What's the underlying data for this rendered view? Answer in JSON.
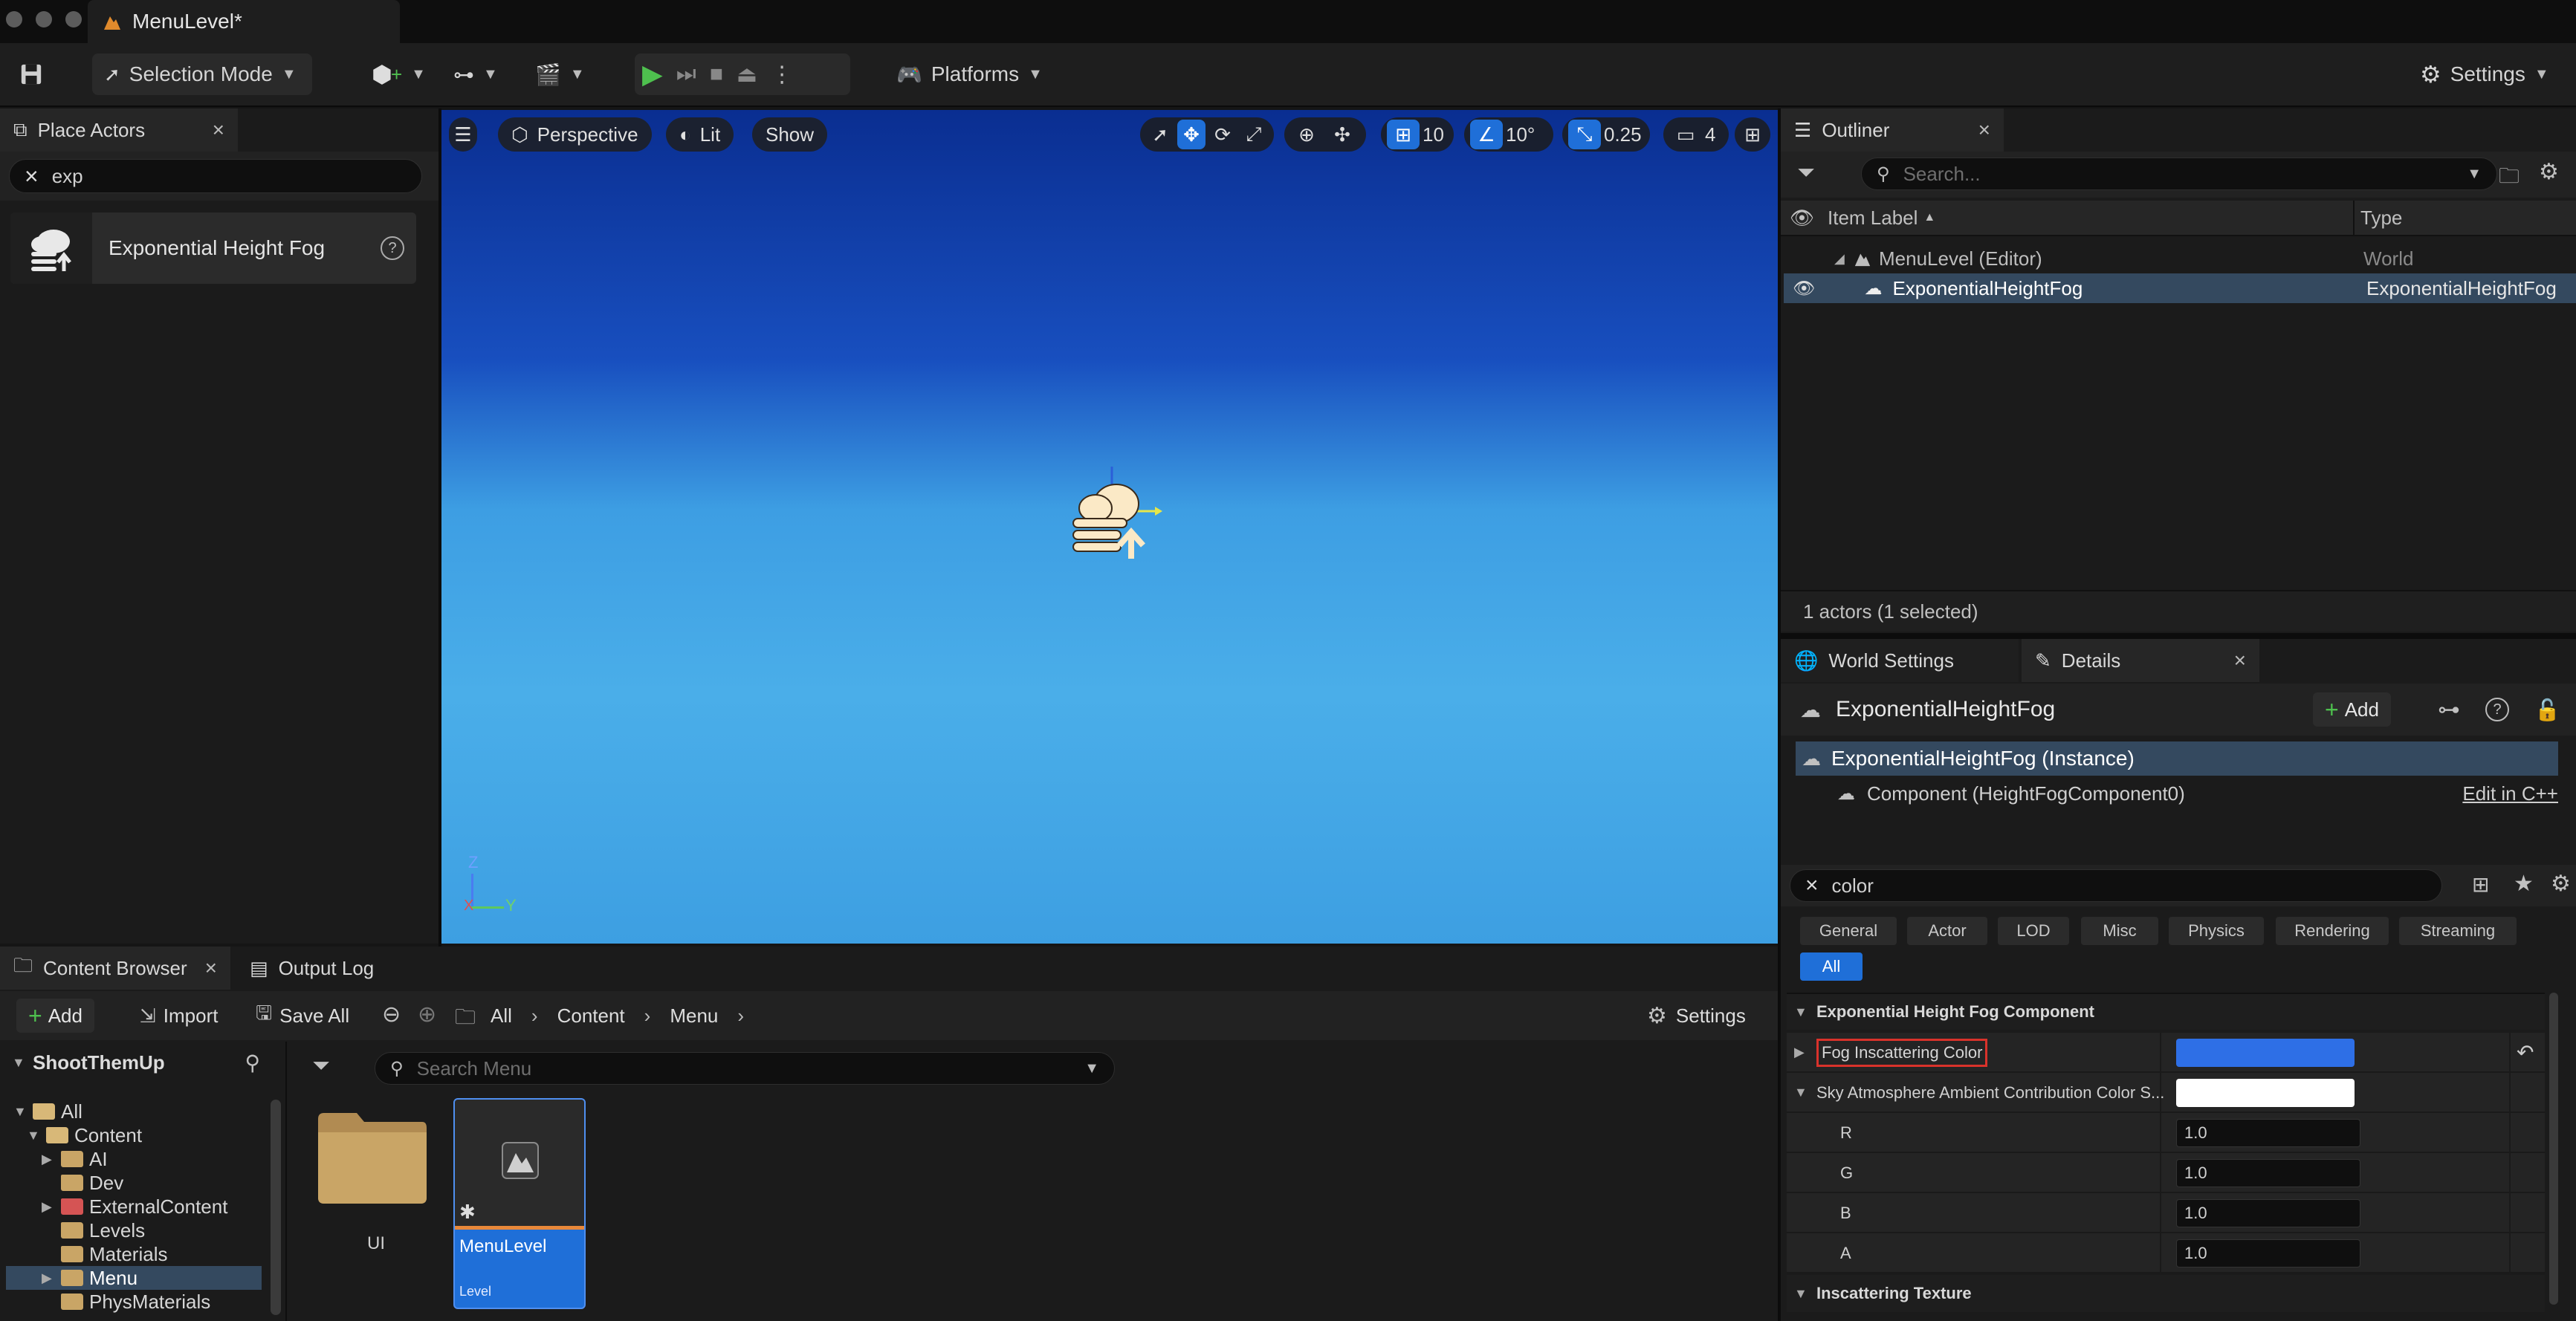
{
  "window": {
    "title": "MenuLevel*"
  },
  "toolbar": {
    "selection_mode": "Selection Mode",
    "platforms": "Platforms",
    "settings": "Settings"
  },
  "place_actors": {
    "tab": "Place Actors",
    "search_value": "exp",
    "result_label": "Exponential Height Fog"
  },
  "viewport": {
    "perspective": "Perspective",
    "lit": "Lit",
    "show": "Show",
    "grid_snap": "10",
    "rotation_snap": "10°",
    "scale_snap": "0.25",
    "camera_speed": "4",
    "axis_z": "Z",
    "axis_x": "X",
    "axis_y": "Y"
  },
  "outliner": {
    "tab": "Outliner",
    "search_placeholder": "Search...",
    "col_label": "Item Label",
    "col_type": "Type",
    "rows": [
      {
        "label": "MenuLevel (Editor)",
        "type": "World"
      },
      {
        "label": "ExponentialHeightFog",
        "type": "ExponentialHeightFog"
      }
    ],
    "status": "1 actors (1 selected)"
  },
  "details": {
    "tab_world": "World Settings",
    "tab_details": "Details",
    "actor_name": "ExponentialHeightFog",
    "add_label": "Add",
    "instance": "ExponentialHeightFog (Instance)",
    "component": "Component (HeightFogComponent0)",
    "edit_cpp": "Edit in C++",
    "search_value": "color",
    "categories": [
      "General",
      "Actor",
      "LOD",
      "Misc",
      "Physics",
      "Rendering",
      "Streaming"
    ],
    "all_label": "All",
    "section": "Exponential Height Fog Component",
    "fog_color_label": "Fog Inscattering Color",
    "fog_color": "#2e6fe6",
    "sky_label": "Sky Atmosphere Ambient Contribution Color S...",
    "sky_color": "#ffffff",
    "channels": [
      {
        "name": "R",
        "value": "1.0"
      },
      {
        "name": "G",
        "value": "1.0"
      },
      {
        "name": "B",
        "value": "1.0"
      },
      {
        "name": "A",
        "value": "1.0"
      }
    ],
    "section2": "Inscattering Texture"
  },
  "content_browser": {
    "tab": "Content Browser",
    "output_tab": "Output Log",
    "add": "Add",
    "import": "Import",
    "save_all": "Save All",
    "crumbs": [
      "All",
      "Content",
      "Menu"
    ],
    "settings": "Settings",
    "project": "ShootThemUp",
    "search_placeholder": "Search Menu",
    "tree": [
      "All",
      "Content",
      "AI",
      "Dev",
      "ExternalContent",
      "Levels",
      "Materials",
      "Menu",
      "PhysMaterials"
    ],
    "assets": [
      {
        "name": "UI",
        "kind": ""
      },
      {
        "name": "MenuLevel",
        "kind": "Level"
      }
    ]
  }
}
